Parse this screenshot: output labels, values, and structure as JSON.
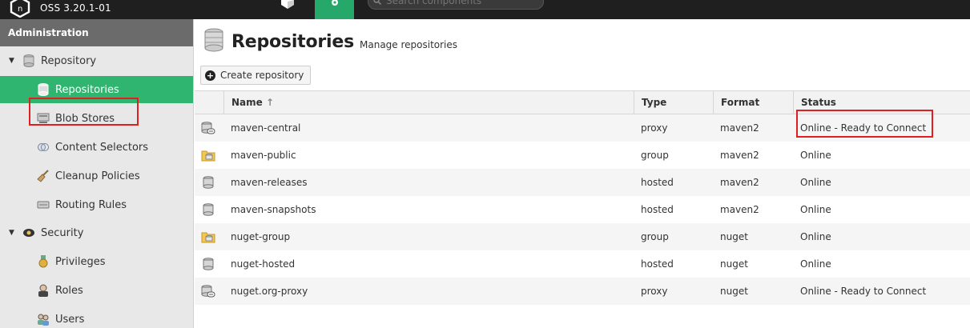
{
  "header": {
    "version": "OSS 3.20.1-01",
    "search_placeholder": "Search components"
  },
  "sidebar": {
    "title": "Administration",
    "items": [
      {
        "label": "Repository",
        "icon": "database-icon",
        "group": true
      },
      {
        "label": "Repositories",
        "icon": "database-icon",
        "active": true
      },
      {
        "label": "Blob Stores",
        "icon": "server-icon"
      },
      {
        "label": "Content Selectors",
        "icon": "selector-icon"
      },
      {
        "label": "Cleanup Policies",
        "icon": "broom-icon"
      },
      {
        "label": "Routing Rules",
        "icon": "routing-icon"
      },
      {
        "label": "Security",
        "icon": "security-icon",
        "group": true
      },
      {
        "label": "Privileges",
        "icon": "medal-icon"
      },
      {
        "label": "Roles",
        "icon": "role-icon"
      },
      {
        "label": "Users",
        "icon": "users-icon"
      }
    ]
  },
  "main": {
    "title": "Repositories",
    "subtitle": "Manage repositories",
    "create_label": "Create repository"
  },
  "grid": {
    "columns": [
      "Name",
      "Type",
      "Format",
      "Status"
    ],
    "rows": [
      {
        "name": "maven-central",
        "type": "proxy",
        "format": "maven2",
        "status": "Online - Ready to Connect",
        "icon": "proxy-repo-icon"
      },
      {
        "name": "maven-public",
        "type": "group",
        "format": "maven2",
        "status": "Online",
        "icon": "group-repo-icon"
      },
      {
        "name": "maven-releases",
        "type": "hosted",
        "format": "maven2",
        "status": "Online",
        "icon": "hosted-repo-icon"
      },
      {
        "name": "maven-snapshots",
        "type": "hosted",
        "format": "maven2",
        "status": "Online",
        "icon": "hosted-repo-icon"
      },
      {
        "name": "nuget-group",
        "type": "group",
        "format": "nuget",
        "status": "Online",
        "icon": "group-repo-icon"
      },
      {
        "name": "nuget-hosted",
        "type": "hosted",
        "format": "nuget",
        "status": "Online",
        "icon": "hosted-repo-icon"
      },
      {
        "name": "nuget.org-proxy",
        "type": "proxy",
        "format": "nuget",
        "status": "Online - Ready to Connect",
        "icon": "proxy-repo-icon"
      }
    ]
  },
  "colors": {
    "accent": "#2fb56f",
    "highlight": "#e02020",
    "topbar": "#1f1f1f"
  }
}
